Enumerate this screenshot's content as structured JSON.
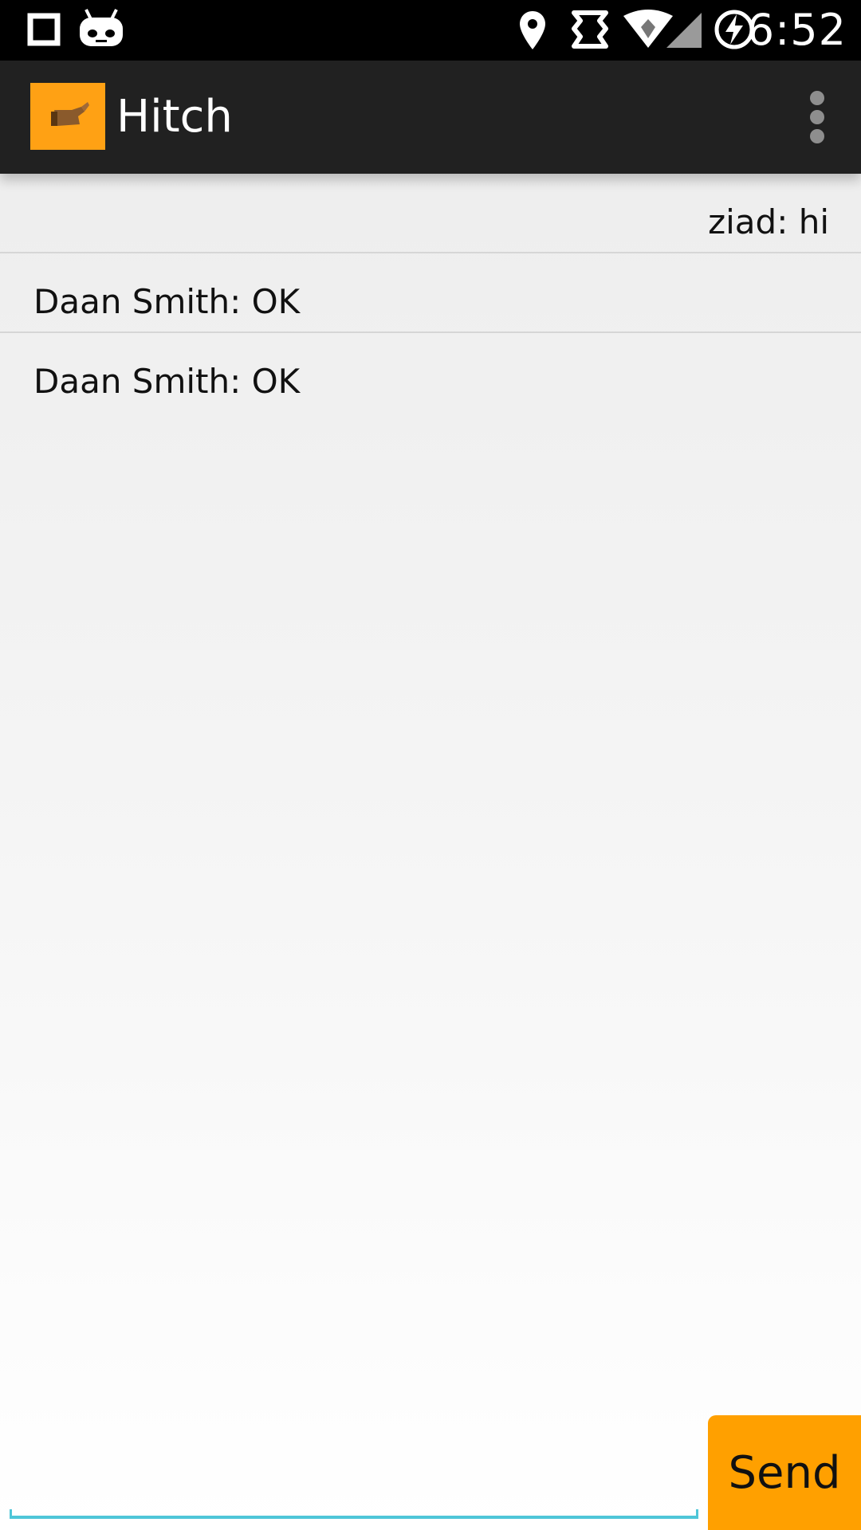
{
  "status_bar": {
    "time": "6:52",
    "icons": [
      "square-notification-icon",
      "android-robot-icon",
      "location-pin-icon",
      "sync-icon",
      "wifi-icon",
      "cell-signal-icon",
      "battery-charging-icon"
    ]
  },
  "action_bar": {
    "title": "Hitch",
    "app_icon": "thumbs-up-hand-icon",
    "accent_color": "#ffa114",
    "overflow_icon": "overflow-menu-icon"
  },
  "messages": [
    {
      "text": "ziad: hi",
      "direction": "outgoing"
    },
    {
      "text": "Daan Smith: OK",
      "direction": "incoming"
    },
    {
      "text": "Daan Smith: OK",
      "direction": "incoming"
    }
  ],
  "compose": {
    "input_value": "",
    "placeholder": "",
    "send_label": "Send",
    "send_color": "#ffa000",
    "underline_color": "#4fc6d8"
  }
}
